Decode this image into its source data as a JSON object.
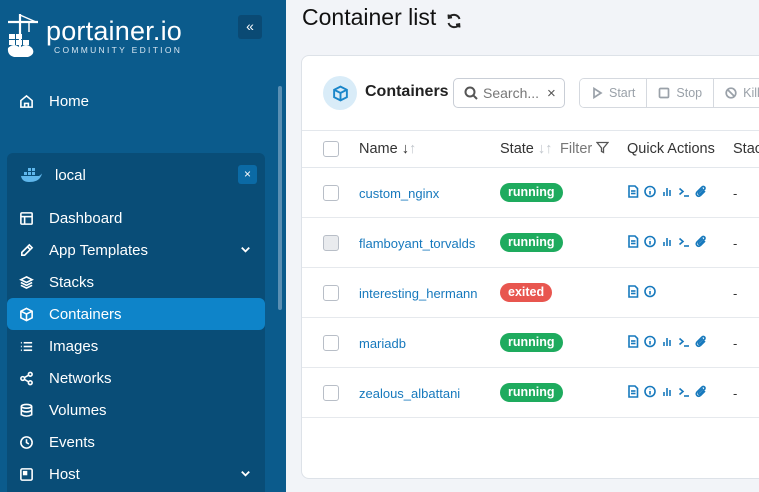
{
  "app": {
    "logo_text": "portainer.io",
    "logo_sub": "COMMUNITY EDITION",
    "collapse_glyph": "«"
  },
  "sidebar": {
    "home": "Home",
    "environment": {
      "name": "local",
      "close_glyph": "×"
    },
    "items": [
      {
        "label": "Dashboard",
        "icon": "dashboard-icon"
      },
      {
        "label": "App Templates",
        "icon": "edit-icon",
        "expandable": true
      },
      {
        "label": "Stacks",
        "icon": "layers-icon"
      },
      {
        "label": "Containers",
        "icon": "cube-icon",
        "active": true
      },
      {
        "label": "Images",
        "icon": "list-icon"
      },
      {
        "label": "Networks",
        "icon": "share-icon"
      },
      {
        "label": "Volumes",
        "icon": "database-icon"
      },
      {
        "label": "Events",
        "icon": "clock-icon"
      },
      {
        "label": "Host",
        "icon": "server-icon",
        "expandable": true
      }
    ]
  },
  "page": {
    "title": "Container list"
  },
  "card": {
    "title": "Containers",
    "search": {
      "placeholder": "Search...",
      "value": ""
    },
    "clear_glyph": "×",
    "buttons": {
      "start": "Start",
      "stop": "Stop",
      "kill": "Kill"
    }
  },
  "table": {
    "headers": {
      "name": "Name",
      "state": "State",
      "filter": "Filter",
      "quick_actions": "Quick Actions",
      "stack": "Stac"
    },
    "rows": [
      {
        "name": "custom_nginx",
        "state": "running",
        "stack": "-",
        "checkbox_disabled": false
      },
      {
        "name": "flamboyant_torvalds",
        "state": "running",
        "stack": "-",
        "checkbox_disabled": true
      },
      {
        "name": "interesting_hermann",
        "state": "exited",
        "stack": "-",
        "checkbox_disabled": false
      },
      {
        "name": "mariadb",
        "state": "running",
        "stack": "-",
        "checkbox_disabled": false
      },
      {
        "name": "zealous_albattani",
        "state": "running",
        "stack": "-",
        "checkbox_disabled": false
      }
    ]
  },
  "colors": {
    "sidebar": "#0b5b8c",
    "active": "#0e84c9",
    "link": "#1779bd",
    "running": "#1eab5e",
    "exited": "#e8564f"
  }
}
